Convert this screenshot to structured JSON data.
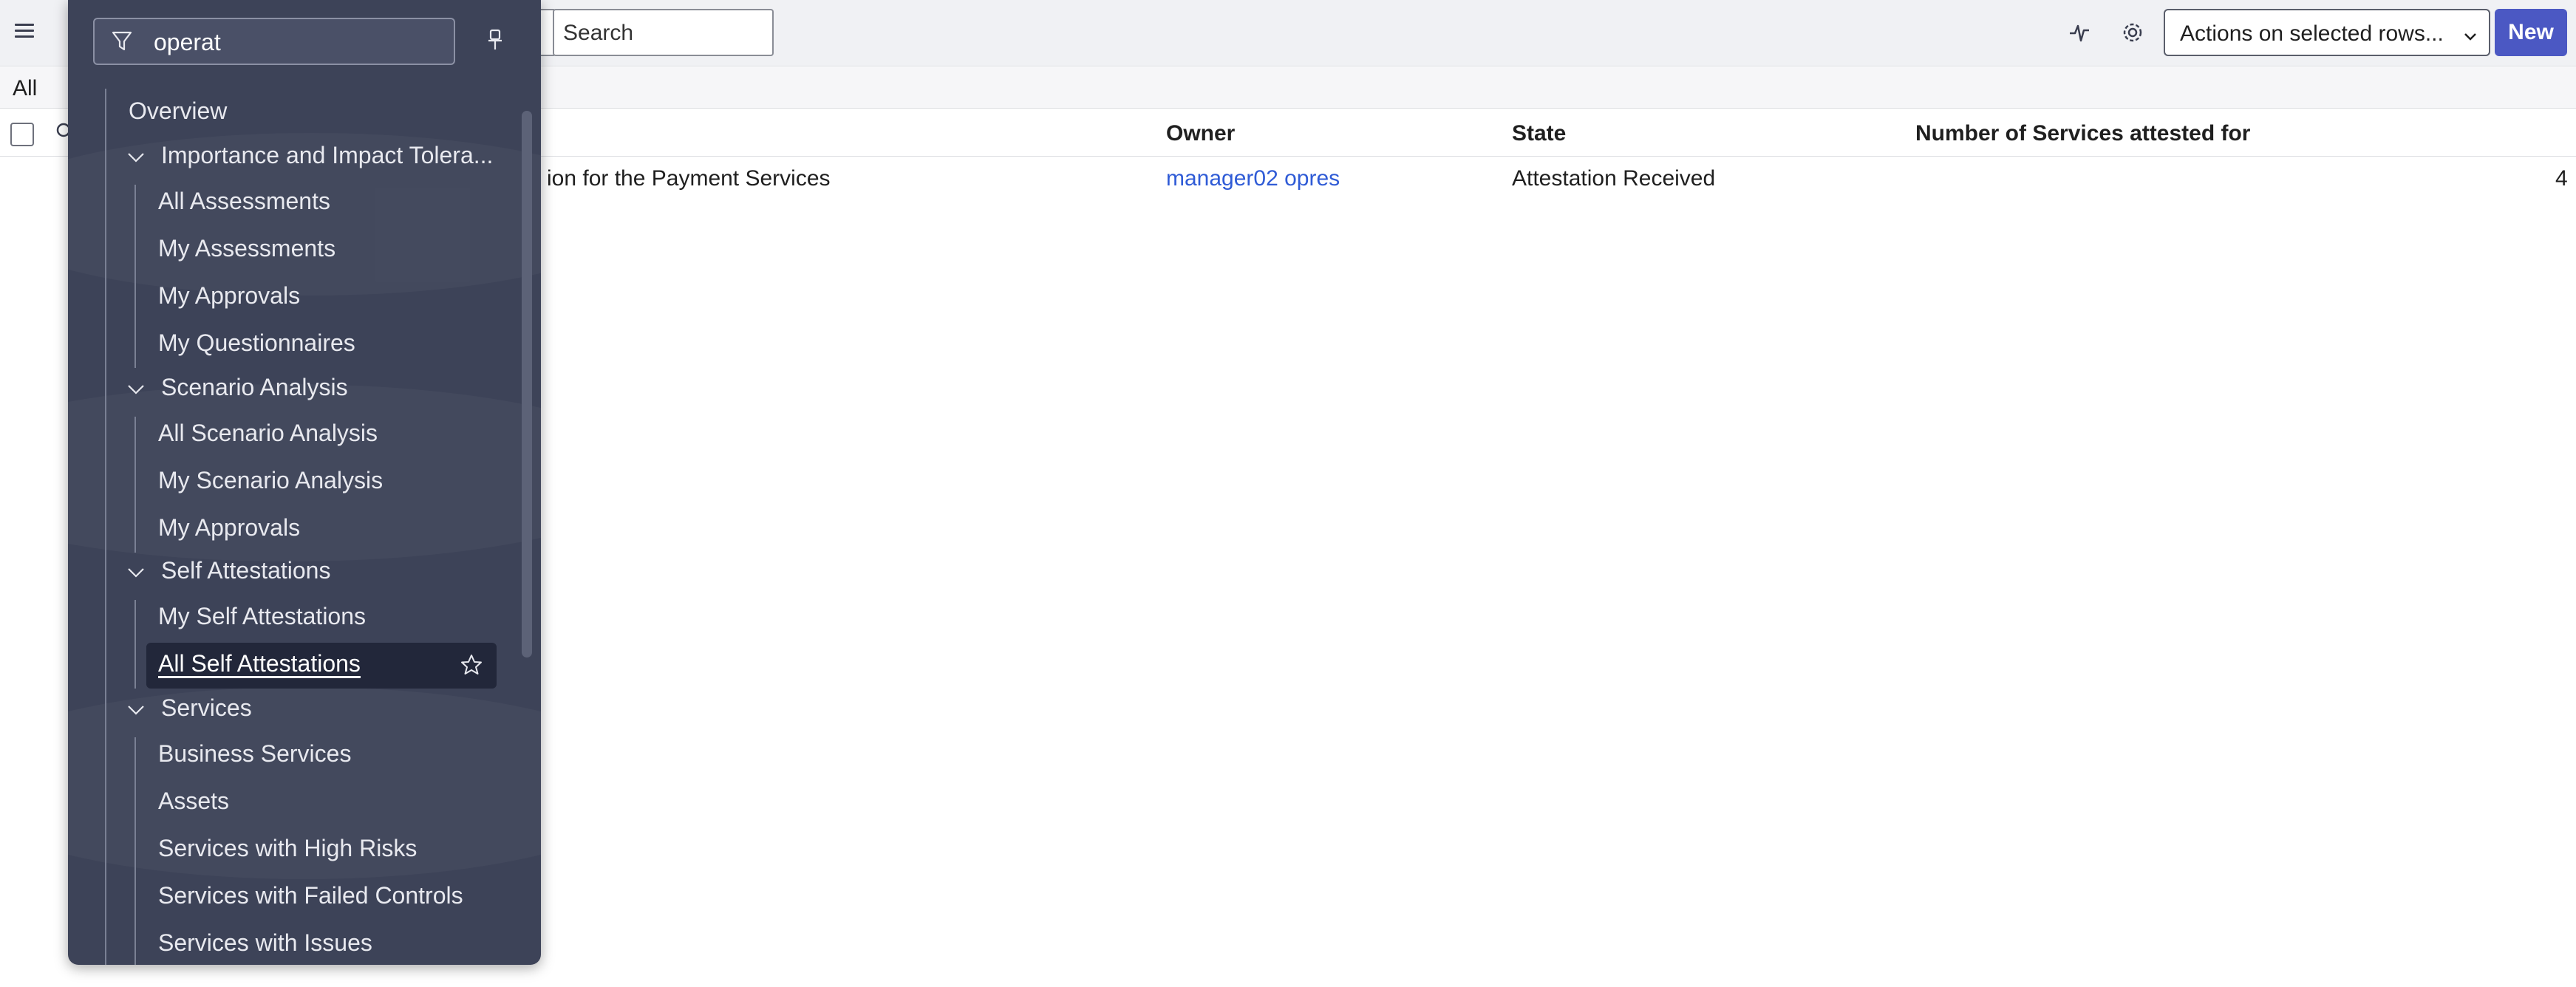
{
  "toolbar": {
    "search_placeholder": "Search",
    "actions_label": "Actions on selected rows...",
    "new_label": "New"
  },
  "filterbar": {
    "breadcrumb": "All"
  },
  "table": {
    "columns": [
      "Owner",
      "State",
      "Number of Services attested for"
    ],
    "row": {
      "name_fragment": "ion for the Payment Services",
      "owner": "manager02 opres",
      "state": "Attestation Received",
      "count": "4"
    }
  },
  "navigator": {
    "filter_value": "operat",
    "overview": "Overview",
    "groups": [
      {
        "label": "Importance and Impact Tolera...",
        "items": [
          "All Assessments",
          "My Assessments",
          "My Approvals",
          "My Questionnaires"
        ]
      },
      {
        "label": "Scenario Analysis",
        "items": [
          "All Scenario Analysis",
          "My Scenario Analysis",
          "My Approvals"
        ]
      },
      {
        "label": "Self Attestations",
        "items": [
          "My Self Attestations",
          "All Self Attestations"
        ]
      },
      {
        "label": "Services",
        "items": [
          "Business Services",
          "Assets",
          "Services with High Risks",
          "Services with Failed Controls",
          "Services with Issues"
        ]
      }
    ]
  },
  "icons": [
    "hamburger-icon",
    "pulse-icon",
    "gear-icon",
    "chevron-down-icon",
    "search-icon",
    "funnel-icon",
    "pin-icon",
    "star-icon"
  ],
  "colors": {
    "nav_background": "#3d4358",
    "primary_button": "#4b58c3",
    "link": "#2f5bd6"
  }
}
